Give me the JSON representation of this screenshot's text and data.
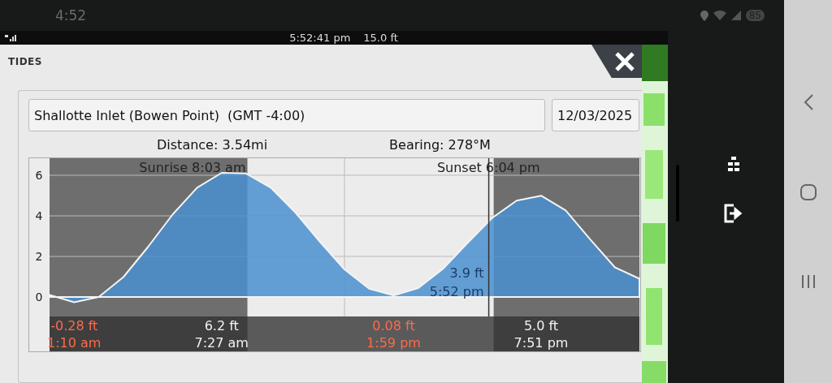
{
  "phone_status": {
    "time": "4:52",
    "battery": "85"
  },
  "app_bar": {
    "time": "5:52:41 pm",
    "depth": "15.0 ft"
  },
  "dialog": {
    "title": "TIDES"
  },
  "station": {
    "value": "Shallotte Inlet (Bowen Point)  (GMT -4:00)"
  },
  "date": {
    "value": "12/03/2025"
  },
  "distance": "Distance: 3.54mi",
  "bearing": "Bearing: 278°M",
  "chart": {
    "sunrise": "Sunrise 8:03 am",
    "sunset": "Sunset 6:04 pm",
    "current": {
      "height": "3.9 ft",
      "time": "5:52 pm"
    },
    "extremes": [
      {
        "kind": "low",
        "height": "-0.28 ft",
        "time": "1:10 am"
      },
      {
        "kind": "high",
        "height": "6.2 ft",
        "time": "7:27 am"
      },
      {
        "kind": "low",
        "height": "0.08 ft",
        "time": "1:59 pm"
      },
      {
        "kind": "high",
        "height": "5.0 ft",
        "time": "7:51 pm"
      }
    ],
    "chart_data": {
      "type": "area",
      "grid": true,
      "categories": [
        null,
        null,
        null,
        null,
        null,
        null,
        null,
        null,
        null,
        null,
        null,
        null,
        null,
        null,
        null,
        null,
        null,
        null,
        null,
        null,
        null,
        null,
        null,
        null,
        null
      ],
      "series": [
        {
          "color": "#4a90d0",
          "values": [
            0.1,
            -0.26,
            0.0,
            0.98,
            2.46,
            4.06,
            5.39,
            6.12,
            6.09,
            5.39,
            4.17,
            2.72,
            1.36,
            0.41,
            0.08,
            0.44,
            1.38,
            2.66,
            3.89,
            4.75,
            4.99,
            4.27,
            2.83,
            1.46,
            0.9
          ]
        }
      ],
      "ylim": [
        -0.96,
        6.84
      ],
      "yticks": [
        {
          "value": 0,
          "label": "0"
        },
        {
          "value": 2,
          "label": "2"
        },
        {
          "value": 4,
          "label": "4"
        },
        {
          "value": 6,
          "label": "6"
        }
      ]
    }
  }
}
